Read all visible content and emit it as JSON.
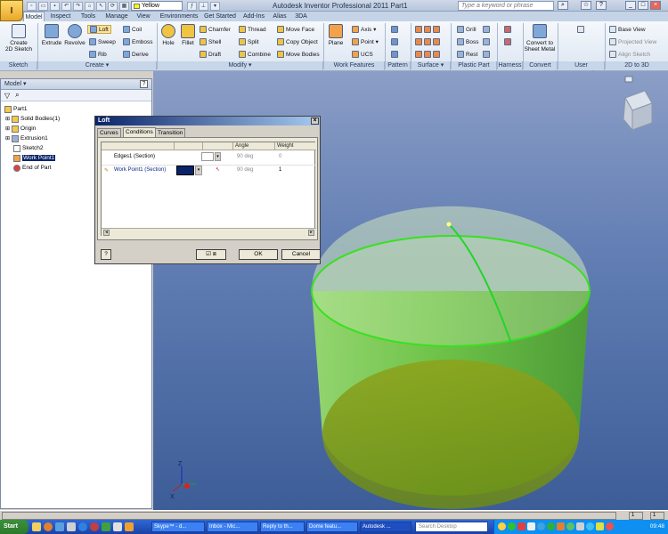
{
  "app": {
    "title": "Autodesk Inventor Professional 2011   Part1",
    "logo": "I"
  },
  "qat": {
    "color_value": "Yellow",
    "search_placeholder": "Type a keyword or phrase"
  },
  "tabs": [
    "Model",
    "Inspect",
    "Tools",
    "Manage",
    "View",
    "Environments",
    "Get Started",
    "Add-Ins",
    "Alias",
    "3DA"
  ],
  "ribbon": {
    "sketch": {
      "create_2d_sketch": "Create\n2D Sketch",
      "title": "Sketch"
    },
    "create": {
      "extrude": "Extrude",
      "revolve": "Revolve",
      "loft": "Loft",
      "sweep": "Sweep",
      "rib": "Rib",
      "coil": "Coil",
      "emboss": "Emboss",
      "derive": "Derive",
      "title": "Create ▾"
    },
    "modify": {
      "hole": "Hole",
      "fillet": "Fillet",
      "chamfer": "Chamfer",
      "shell": "Shell",
      "draft": "Draft",
      "thread": "Thread",
      "split": "Split",
      "combine": "Combine",
      "move_face": "Move Face",
      "copy_object": "Copy Object",
      "move_bodies": "Move Bodies",
      "title": "Modify ▾"
    },
    "work_features": {
      "plane": "Plane",
      "axis": "Axis ▾",
      "point": "Point ▾",
      "ucs": "UCS",
      "title": "Work Features"
    },
    "pattern": {
      "title": "Pattern"
    },
    "surface": {
      "title": "Surface ▾"
    },
    "plastic": {
      "grill": "Grill",
      "boss": "Boss",
      "rest": "Rest",
      "title": "Plastic Part"
    },
    "harness": {
      "title": "Harness"
    },
    "convert": {
      "convert_sheet_metal": "Convert to\nSheet Metal",
      "title": "Convert"
    },
    "user_commands": {
      "title": "User Commands"
    },
    "to3d": {
      "base_view": "Base View",
      "projected_view": "Projected View",
      "align_sketch": "Align Sketch",
      "title": "2D to 3D"
    }
  },
  "browser": {
    "header": "Model ▾",
    "help": "?",
    "items": [
      {
        "label": "Part1"
      },
      {
        "label": "Solid Bodies(1)"
      },
      {
        "label": "Origin"
      },
      {
        "label": "Extrusion1"
      },
      {
        "label": "Sketch2"
      },
      {
        "label": "Work Point1"
      },
      {
        "label": "End of Part"
      }
    ]
  },
  "dialog": {
    "title": "Loft",
    "tabs": [
      "Curves",
      "Conditions",
      "Transition"
    ],
    "columns": [
      "",
      "Angle",
      "Weight"
    ],
    "rows": [
      {
        "name": "Edges1 (Section)",
        "angle": "90 deg",
        "weight": "0"
      },
      {
        "name": "Work Point1 (Section)",
        "angle": "90 deg",
        "weight": "1"
      }
    ],
    "ok": "OK",
    "cancel": "Cancel",
    "help": "?"
  },
  "statusbar": {
    "left": "",
    "right1": "1",
    "right2": "1"
  },
  "taskbar": {
    "start": "Start",
    "items": [
      "Skype™ - d...",
      "Inbox - Mic...",
      "Reply to th...",
      "Dome featu...",
      "Autodesk ..."
    ],
    "search": "Search Desktop",
    "clock": "09:48"
  },
  "colors": {
    "yellow_swatch": "#ffff00",
    "body_green": "#55c030",
    "viewport_top": "#8b9ec6",
    "viewport_bottom": "#3d5d98"
  }
}
